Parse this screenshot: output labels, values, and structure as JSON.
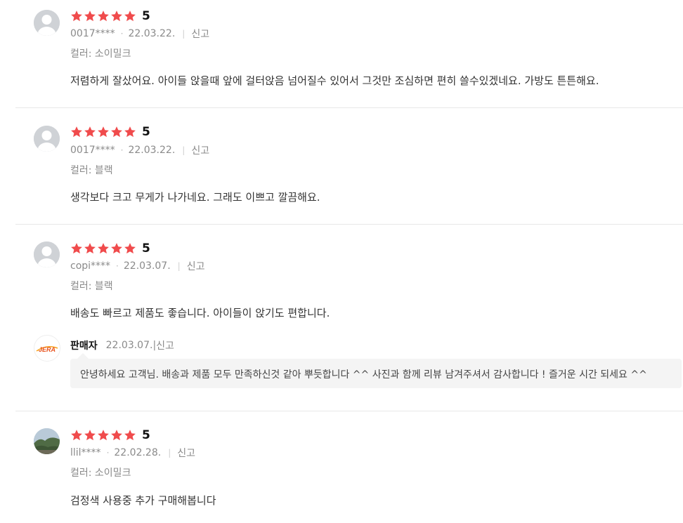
{
  "colors": {
    "star": "#f04b4c",
    "divider": "#e8e8e8",
    "reply_bg": "#f4f4f4"
  },
  "common": {
    "report_label": "신고",
    "dot": "·",
    "bar": "|"
  },
  "reviews": [
    {
      "rating": 5,
      "score_label": "5",
      "user": "0017****",
      "date": "22.03.22.",
      "option": "컬러: 소이밀크",
      "text": "저렴하게 잘샀어요. 아이들 앉을때 앞에 걸터앉음 넘어질수 있어서 그것만 조심하면 편히 쓸수있겠네요. 가방도 튼튼해요.",
      "avatar": "default-avatar-icon"
    },
    {
      "rating": 5,
      "score_label": "5",
      "user": "0017****",
      "date": "22.03.22.",
      "option": "컬러: 블랙",
      "text": "생각보다 크고 무게가 나가네요. 그래도 이쁘고 깔끔해요.",
      "avatar": "default-avatar-icon"
    },
    {
      "rating": 5,
      "score_label": "5",
      "user": "copi****",
      "date": "22.03.07.",
      "option": "컬러: 블랙",
      "text": "배송도 빠르고 제품도 좋습니다. 아이들이 앉기도 편합니다.",
      "avatar": "default-avatar-icon",
      "reply": {
        "seller_name": "판매자",
        "date": "22.03.07.",
        "logo_text": "JERA",
        "text": "안녕하세요 고객님. 배송과 제품 모두 만족하신것 같아 뿌듯합니다 ^^ 사진과 함께 리뷰 남겨주셔서 감사합니다 ! 즐거운 시간 되세요 ^^"
      }
    },
    {
      "rating": 5,
      "score_label": "5",
      "user": "llil****",
      "date": "22.02.28.",
      "option": "컬러: 소이밀크",
      "text": "검정색 사용중 추가 구매해봅니다",
      "avatar": "landscape-photo-avatar"
    }
  ]
}
